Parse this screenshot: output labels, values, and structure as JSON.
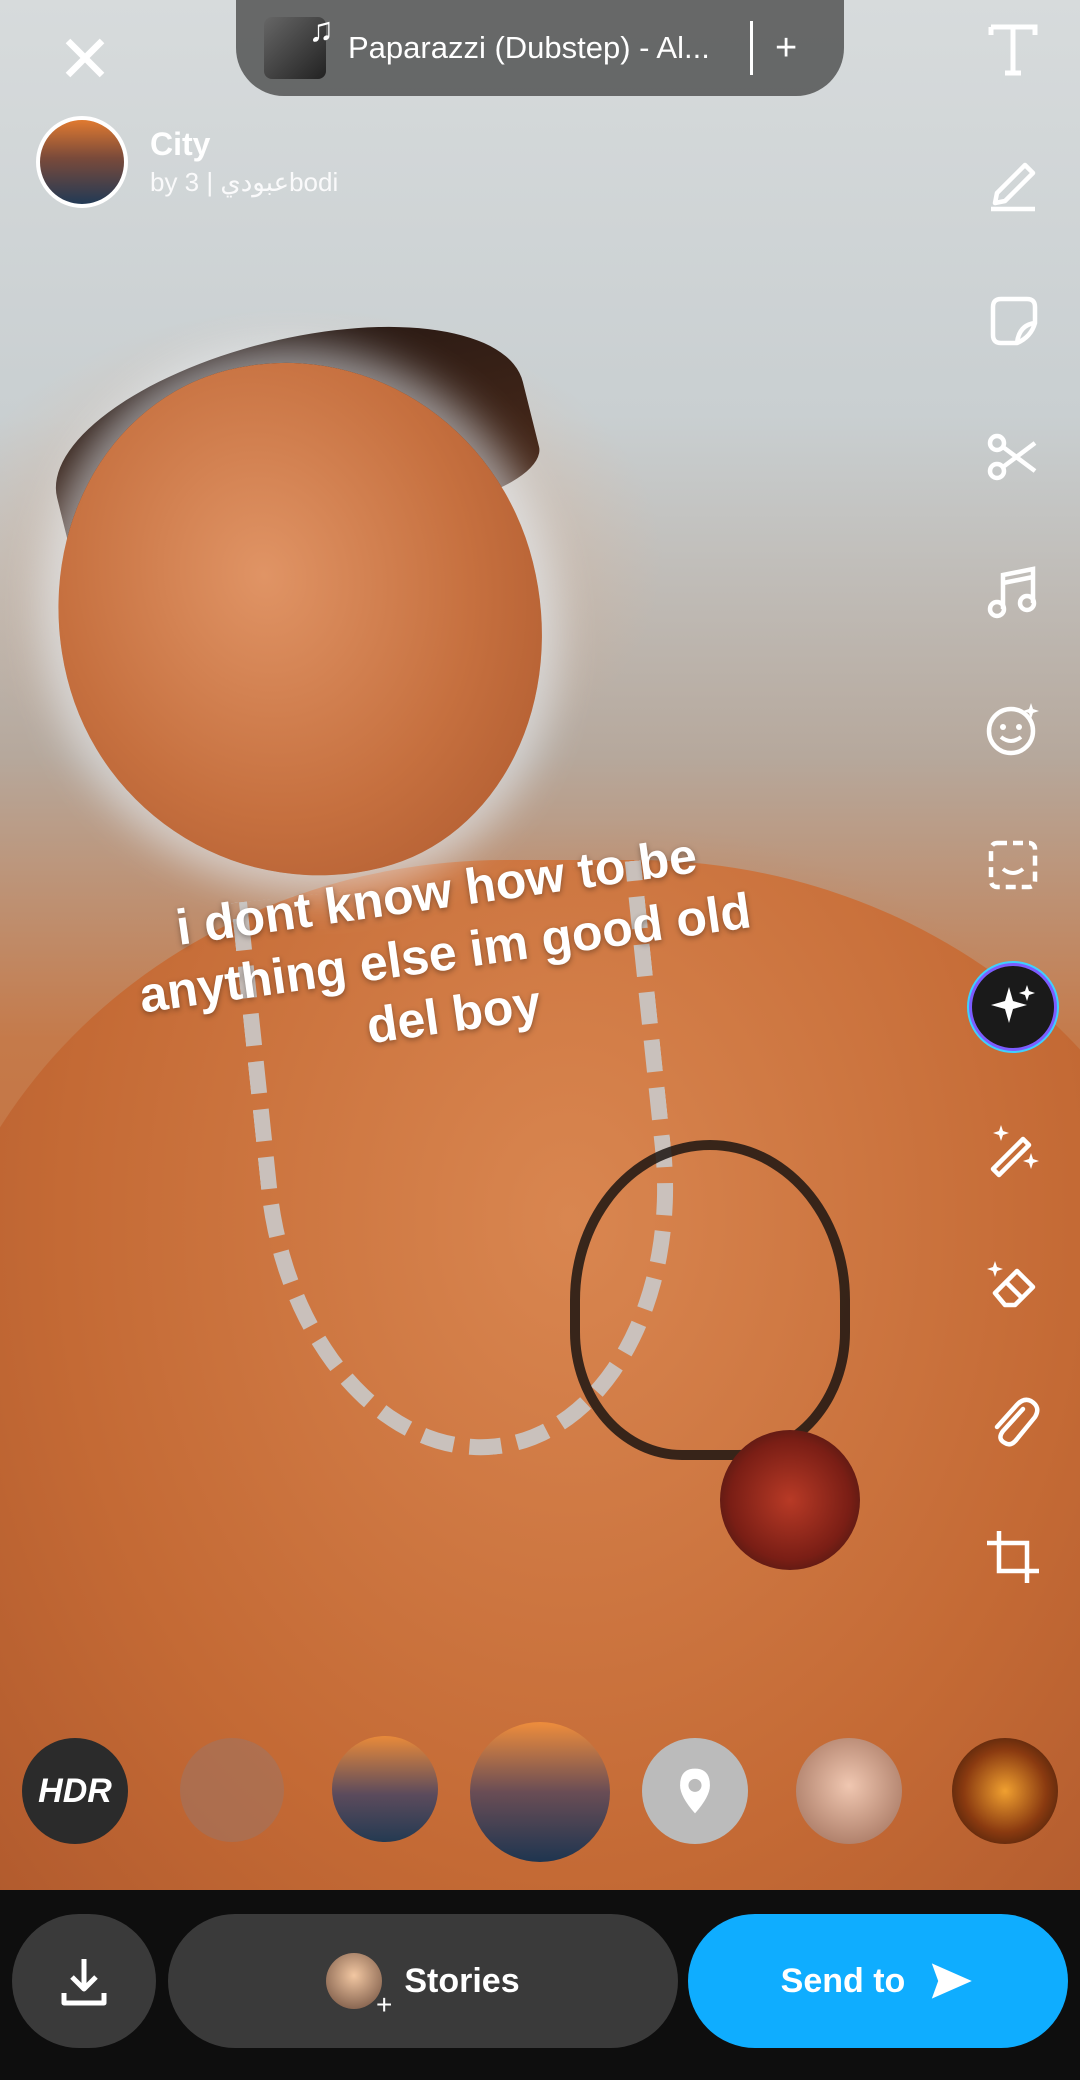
{
  "music": {
    "title": "Paparazzi (Dubstep) - Al...",
    "add_icon": "plus-icon",
    "note_icon": "music-note-icon"
  },
  "lens": {
    "name": "City",
    "byline": "by 3 | عبوديbodi"
  },
  "caption": {
    "text": "i dont know how to be anything else im good old del boy"
  },
  "tools": [
    "text-icon",
    "pen-icon",
    "sticker-icon",
    "scissors-icon",
    "music-icon",
    "emoji-lens-icon",
    "scan-icon",
    "ai-sparkle-icon",
    "magic-wand-icon",
    "eraser-icon",
    "paperclip-icon",
    "crop-icon"
  ],
  "lens_carousel": {
    "hdr_label": "HDR"
  },
  "bottom": {
    "stories_label": "Stories",
    "send_label": "Send to"
  },
  "colors": {
    "send_button": "#0fadff",
    "bar_bg": "#0e0e0e",
    "pill_bg": "#3a3a3a"
  }
}
